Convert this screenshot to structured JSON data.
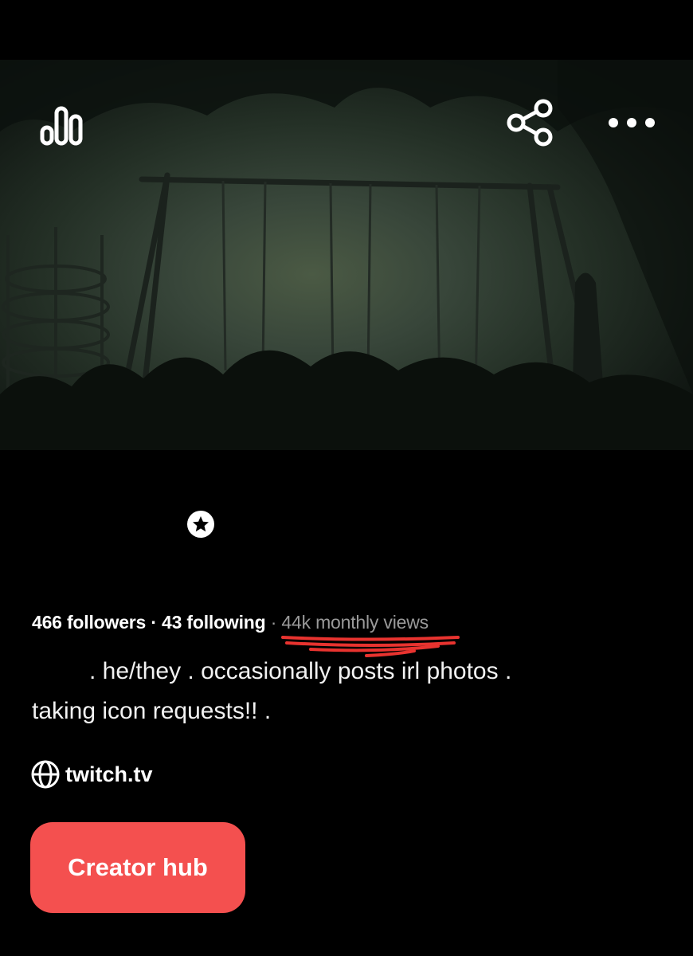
{
  "header": {
    "stats_icon": "bar-chart-icon",
    "share_icon": "share-icon",
    "more_icon": "more-horizontal-icon"
  },
  "profile": {
    "verified_icon": "star-badge-icon",
    "followers": "466 followers",
    "separator": "·",
    "following": "43 following",
    "monthly_views": "44k monthly views",
    "bio_line1": ". he/they . occasionally posts irl photos .",
    "bio_line2": "taking icon requests!! .",
    "link_icon": "globe-icon",
    "link_text": "twitch.tv"
  },
  "actions": {
    "creator_hub_label": "Creator hub"
  },
  "colors": {
    "accent": "#f4504f",
    "background": "#000000",
    "muted_text": "#9a9a9a",
    "scribble": "#e8332f"
  }
}
